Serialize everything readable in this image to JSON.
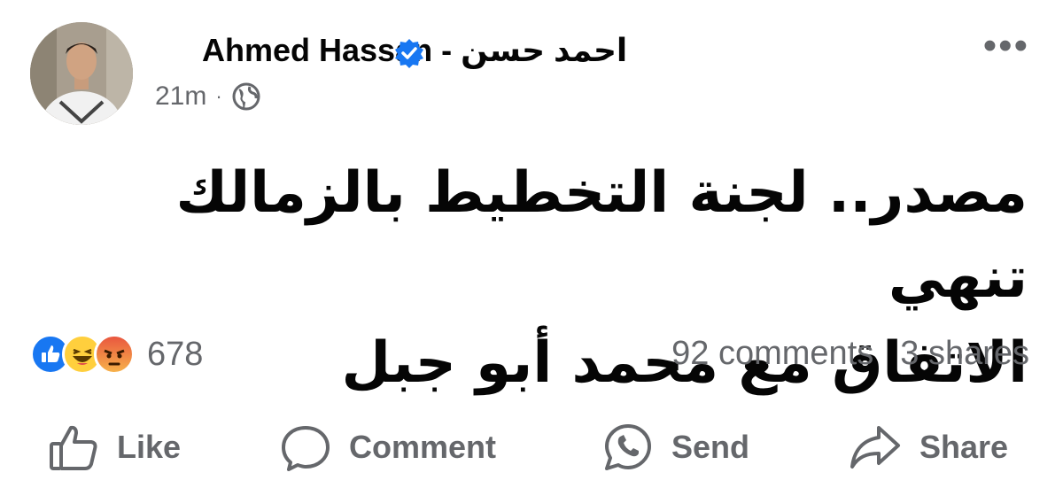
{
  "post": {
    "author": "Ahmed Hassan - احمد حسن",
    "time": "21m",
    "separator": "·",
    "privacy_icon": "globe-icon",
    "menu_icon": "more-options-icon",
    "text_line1": "مصدر.. لجنة التخطيط بالزمالك تنهي",
    "text_line2": "الاتفاق مع محمد أبو جبل"
  },
  "reactions": {
    "types": [
      "like",
      "haha",
      "angry"
    ],
    "count": "678",
    "comments": "92 comments",
    "shares": "3 shares"
  },
  "actions": {
    "like": "Like",
    "comment": "Comment",
    "send": "Send",
    "share": "Share"
  },
  "colors": {
    "text": "#050505",
    "secondary": "#65676b",
    "brand_blue": "#1877f2"
  }
}
